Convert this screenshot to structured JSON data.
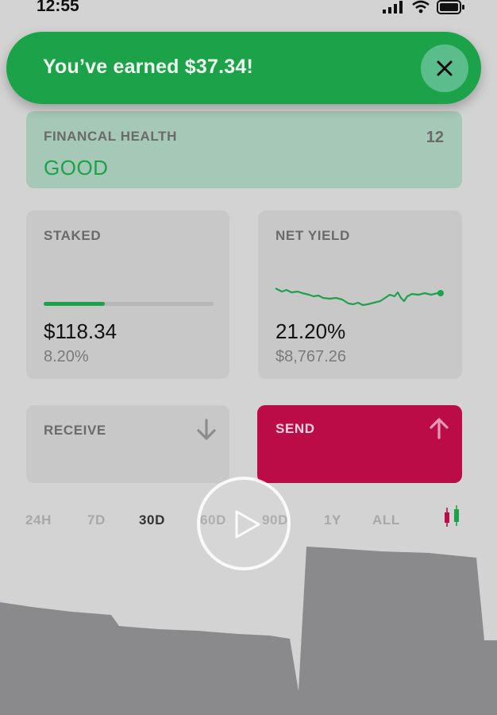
{
  "status_bar": {
    "time": "12:55"
  },
  "toast": {
    "message": "You’ve earned $37.34!"
  },
  "health": {
    "label": "FINANCAL HEALTH",
    "value": "GOOD",
    "score": "12"
  },
  "staked": {
    "label": "STAKED",
    "amount": "$118.34",
    "percent": "8.20%",
    "progress": 0.36
  },
  "net_yield": {
    "label": "NET YIELD",
    "percent": "21.20%",
    "amount": "$8,767.26"
  },
  "actions": {
    "receive_label": "RECEIVE",
    "send_label": "SEND"
  },
  "ranges": [
    "24H",
    "7D",
    "30D",
    "60D",
    "90D",
    "1Y",
    "ALL"
  ],
  "active_range": "30D",
  "colors": {
    "accent_green": "#1ca34a",
    "send_red": "#bb0c48",
    "chart_gray": "#8a898b"
  }
}
